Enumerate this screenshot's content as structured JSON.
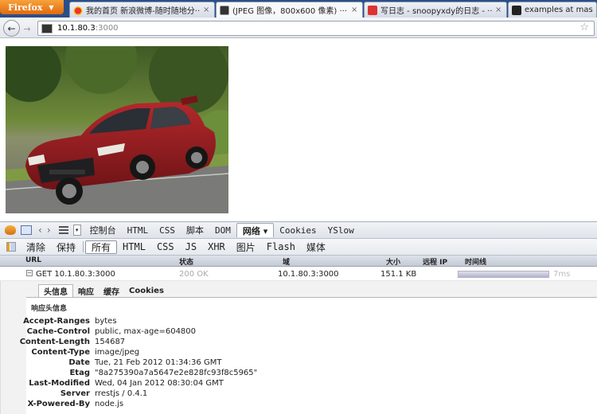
{
  "browser": {
    "app_button": "Firefox",
    "tabs": [
      {
        "title": "我的首页 新浪微博-随时随地分···",
        "icon": "weibo-icon"
      },
      {
        "title": "(JPEG 图像，800x600 像素) ···",
        "icon": "jpeg-icon"
      },
      {
        "title": "写日志 - snoopyxdy的日志 - ···",
        "icon": "snoopy-icon"
      },
      {
        "title": "examples at master",
        "icon": "github-icon"
      }
    ],
    "tab_close": "×",
    "url_host": "10.1.80.3",
    "url_port": ":3000",
    "back_glyph": "←",
    "forward_glyph": "→",
    "bookmark_glyph": "☆"
  },
  "firebug": {
    "panel_tabs": [
      "控制台",
      "HTML",
      "CSS",
      "脚本",
      "DOM",
      "网络 ▾",
      "Cookies",
      "YSlow"
    ],
    "active_panel_index": 5,
    "net_buttons": [
      "清除",
      "保持",
      "所有",
      "HTML",
      "CSS",
      "JS",
      "XHR",
      "图片",
      "Flash",
      "媒体"
    ],
    "active_net_button_index": 2,
    "columns": {
      "url": "URL",
      "status": "状态",
      "domain": "域",
      "size": "大小",
      "remote_ip": "远程 IP",
      "timeline": "时间线"
    },
    "request": {
      "method_url": "GET 10.1.80.3:3000",
      "status": "200 OK",
      "domain": "10.1.80.3:3000",
      "size": "151.1 KB",
      "time": "7ms",
      "twisty": "−"
    },
    "detail_tabs": [
      "头信息",
      "响应",
      "缓存",
      "Cookies"
    ],
    "active_detail_tab_index": 0,
    "section_title": "响应头信息",
    "headers": [
      {
        "key": "Accept-Ranges",
        "value": "bytes"
      },
      {
        "key": "Cache-Control",
        "value": "public, max-age=604800"
      },
      {
        "key": "Content-Length",
        "value": "154687"
      },
      {
        "key": "Content-Type",
        "value": "image/jpeg"
      },
      {
        "key": "Date",
        "value": "Tue, 21 Feb 2012 01:34:36 GMT"
      },
      {
        "key": "Etag",
        "value": "\"8a275390a7a5647e2e828fc93f8c5965\""
      },
      {
        "key": "Last-Modified",
        "value": "Wed, 04 Jan 2012 08:30:04 GMT"
      },
      {
        "key": "Server",
        "value": "rrestjs / 0.4.1"
      },
      {
        "key": "X-Powered-By",
        "value": "node.js"
      }
    ]
  },
  "colors": {
    "tabbar": "#2b4f86",
    "firefox_button": "#e8801f",
    "car_body": "#8f1d1f",
    "timeline_bar": "#c9c8dc"
  }
}
